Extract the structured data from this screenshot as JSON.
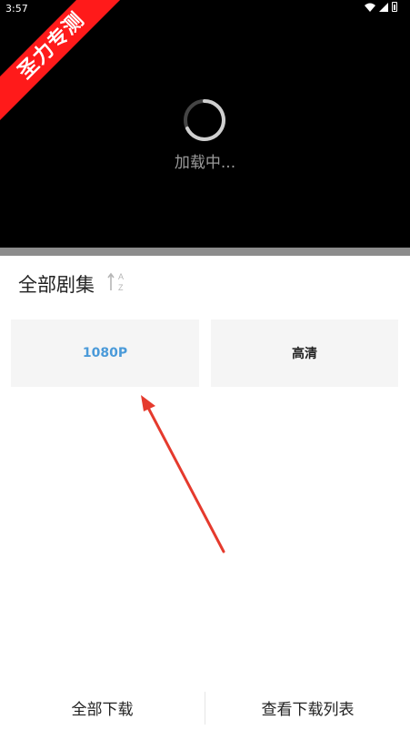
{
  "status_bar": {
    "time": "3:57"
  },
  "watermark": {
    "text": "圣力专测"
  },
  "player": {
    "loading_text": "加载中..."
  },
  "panel": {
    "title": "全部剧集",
    "sort_icon": "sort-az-icon",
    "options": [
      {
        "label": "1080P",
        "selected": true
      },
      {
        "label": "高清",
        "selected": false
      }
    ]
  },
  "bottom": {
    "download_all": "全部下载",
    "view_download_list": "查看下载列表"
  },
  "colors": {
    "accent": "#4a9ad9",
    "ribbon": "#ff1a1a",
    "arrow": "#e53a2d"
  }
}
